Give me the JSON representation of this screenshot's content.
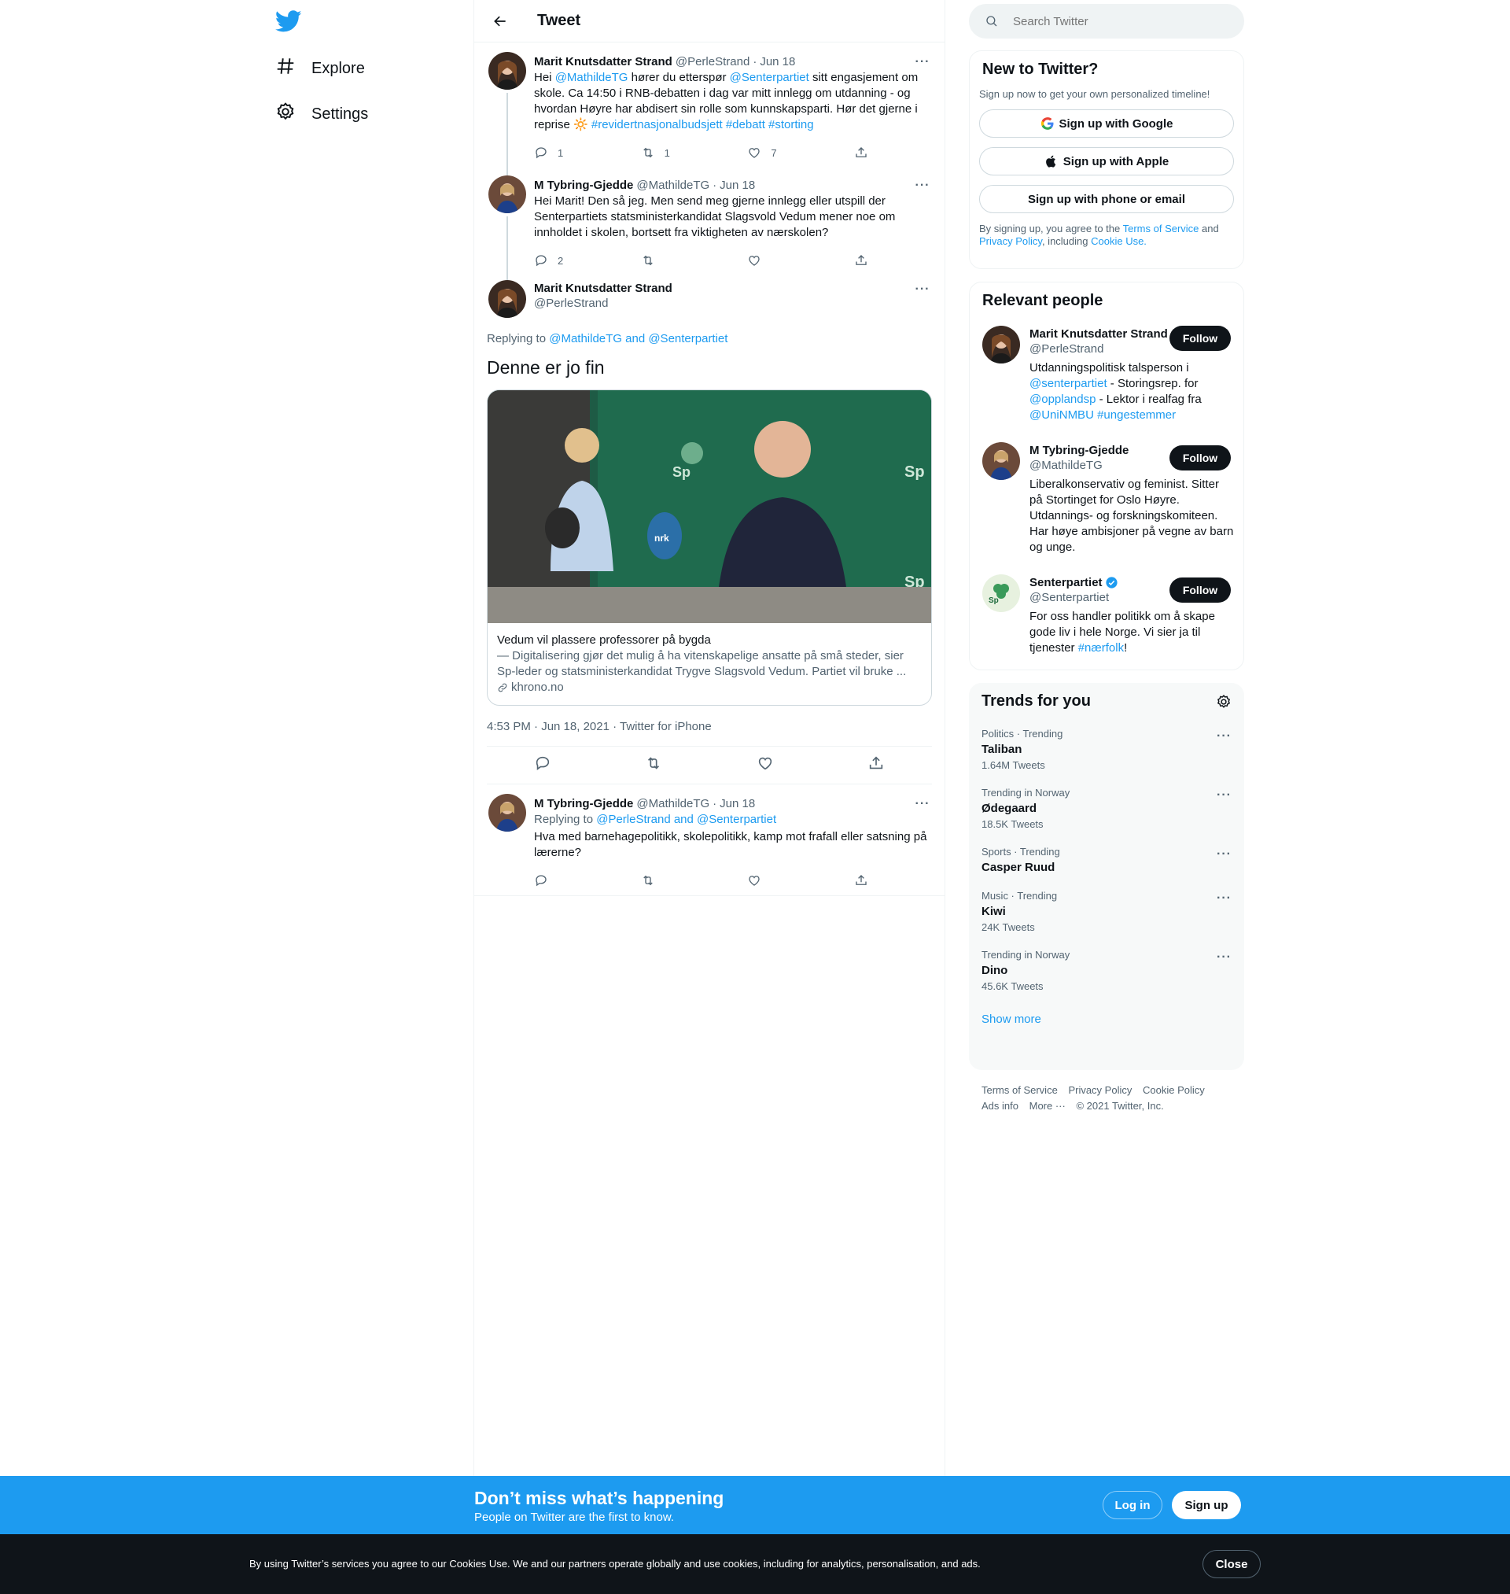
{
  "nav": {
    "explore_label": "Explore",
    "settings_label": "Settings"
  },
  "topbar": {
    "title": "Tweet"
  },
  "thread": [
    {
      "name": "Marit Knutsdatter Strand",
      "handle": "@PerleStrand",
      "date": "Jun 18",
      "text_parts": [
        {
          "t": "Hei ",
          "link": false
        },
        {
          "t": "@MathildeTG",
          "link": true
        },
        {
          "t": " hører du etterspør ",
          "link": false
        },
        {
          "t": "@Senterpartiet",
          "link": true
        },
        {
          "t": " sitt engasjement om skole. Ca 14:50 i RNB-debatten i dag var mitt innlegg om utdanning - og hvordan Høyre har abdisert sin rolle som kunnskapsparti. Hør det gjerne i reprise 🔆 ",
          "link": false
        },
        {
          "t": "#revidertnasjonalbudsjett",
          "link": true
        },
        {
          "t": " ",
          "link": false
        },
        {
          "t": "#debatt",
          "link": true
        },
        {
          "t": " ",
          "link": false
        },
        {
          "t": "#storting",
          "link": true
        }
      ],
      "replies": "1",
      "retweets": "1",
      "likes": "7"
    },
    {
      "name": "M Tybring-Gjedde",
      "handle": "@MathildeTG",
      "date": "Jun 18",
      "text_parts": [
        {
          "t": "Hei Marit! Den så jeg. Men send meg gjerne innlegg eller utspill der Senterpartiets statsministerkandidat Slagsvold Vedum mener noe om innholdet i skolen, bortsett fra viktigheten av nærskolen?",
          "link": false
        }
      ],
      "replies": "2",
      "retweets": "",
      "likes": ""
    }
  ],
  "main_tweet": {
    "name": "Marit Knutsdatter Strand",
    "handle": "@PerleStrand",
    "replying_prefix": "Replying to ",
    "replying_to": "@MathildeTG and @Senterpartiet",
    "text": "Denne er jo fin",
    "card": {
      "title": "Vedum vil plassere professorer på bygda",
      "description": "— Digitalisering gjør det mulig å ha vitenskapelige ansatte på små steder, sier Sp-leder og statsministerkandidat Trygve Slagsvold Vedum. Partiet vil bruke ...",
      "domain": "khrono.no"
    },
    "timestamp": "4:53 PM · Jun 18, 2021 · Twitter for iPhone"
  },
  "reply": {
    "name": "M Tybring-Gjedde",
    "handle": "@MathildeTG",
    "date": "Jun 18",
    "replying_prefix": "Replying to ",
    "replying_to": "@PerleStrand and @Senterpartiet",
    "text": "Hva med barnehagepolitikk, skolepolitikk, kamp mot frafall eller satsning på lærerne?"
  },
  "search": {
    "placeholder": "Search Twitter"
  },
  "signup": {
    "title": "New to Twitter?",
    "subtitle": "Sign up now to get your own personalized timeline!",
    "google": "Sign up with Google",
    "apple": "Sign up with Apple",
    "phone": "Sign up with phone or email",
    "legal_1": "By signing up, you agree to the ",
    "terms": "Terms of Service",
    "legal_2": " and ",
    "privacy": "Privacy Policy",
    "legal_3": ", including ",
    "cookie": "Cookie Use."
  },
  "relevant": {
    "title": "Relevant people",
    "follow_label": "Follow",
    "people": [
      {
        "name": "Marit Knutsdatter Strand",
        "handle": "@PerleStrand",
        "bio_parts": [
          {
            "t": "Utdanningspolitisk talsperson i ",
            "link": false
          },
          {
            "t": "@senterpartiet",
            "link": true
          },
          {
            "t": " - Storingsrep. for ",
            "link": false
          },
          {
            "t": "@opplandsp",
            "link": true
          },
          {
            "t": " - Lektor i realfag fra ",
            "link": false
          },
          {
            "t": "@UniNMBU",
            "link": true
          },
          {
            "t": " ",
            "link": false
          },
          {
            "t": "#ungestemmer",
            "link": true
          }
        ]
      },
      {
        "name": "M Tybring-Gjedde",
        "handle": "@MathildeTG",
        "bio_parts": [
          {
            "t": "Liberalkonservativ og feminist. Sitter på Stortinget for Oslo Høyre. Utdannings- og forskningskomiteen. Har høye ambisjoner på vegne av barn og unge.",
            "link": false
          }
        ]
      },
      {
        "name": "Senterpartiet",
        "handle": "@Senterpartiet",
        "bio_parts": [
          {
            "t": "For oss handler politikk om å skape gode liv i hele Norge. Vi sier ja til tjenester ",
            "link": false
          },
          {
            "t": "#nærfolk",
            "link": true
          },
          {
            "t": "!",
            "link": false
          }
        ]
      }
    ]
  },
  "trends": {
    "title": "Trends for you",
    "items": [
      {
        "category": "Politics · Trending",
        "name": "Taliban",
        "count": "1.64M Tweets"
      },
      {
        "category": "Trending in Norway",
        "name": "Ødegaard",
        "count": "18.5K Tweets"
      },
      {
        "category": "Sports · Trending",
        "name": "Casper Ruud",
        "count": ""
      },
      {
        "category": "Music · Trending",
        "name": "Kiwi",
        "count": "24K Tweets"
      },
      {
        "category": "Trending in Norway",
        "name": "Dino",
        "count": "45.6K Tweets"
      }
    ],
    "show_more": "Show more"
  },
  "footer": {
    "terms": "Terms of Service",
    "privacy": "Privacy Policy",
    "cookie": "Cookie Policy",
    "ads": "Ads info",
    "more": "More ···",
    "copyright": "© 2021 Twitter, Inc."
  },
  "bluebar": {
    "title": "Don’t miss what’s happening",
    "subtitle": "People on Twitter are the first to know.",
    "login": "Log in",
    "signup": "Sign up"
  },
  "cookiebar": {
    "text": "By using Twitter’s services you agree to our Cookies Use. We and our partners operate globally and use cookies, including for analytics, personalisation, and ads.",
    "close": "Close"
  },
  "colors": {
    "brand": "#1d9bf0",
    "text": "#0f1419",
    "secondary": "#536471"
  }
}
